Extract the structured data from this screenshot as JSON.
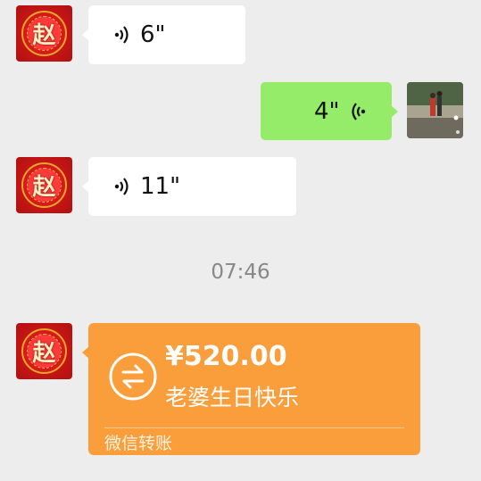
{
  "messages": [
    {
      "side": "left",
      "type": "voice",
      "duration": "6\""
    },
    {
      "side": "right",
      "type": "voice",
      "duration": "4\""
    },
    {
      "side": "left",
      "type": "voice",
      "duration": "11\""
    }
  ],
  "timestamp": "07:46",
  "transfer": {
    "amount": "¥520.00",
    "note": "老婆生日快乐",
    "label": "微信转账"
  },
  "avatar": {
    "glyph": "赵"
  },
  "colors": {
    "background": "#ededed",
    "green_bubble": "#95ec69",
    "white_bubble": "#ffffff",
    "transfer_orange": "#fa9d3b"
  },
  "icons": [
    "voice-wave-icon",
    "transfer-arrows-icon"
  ]
}
